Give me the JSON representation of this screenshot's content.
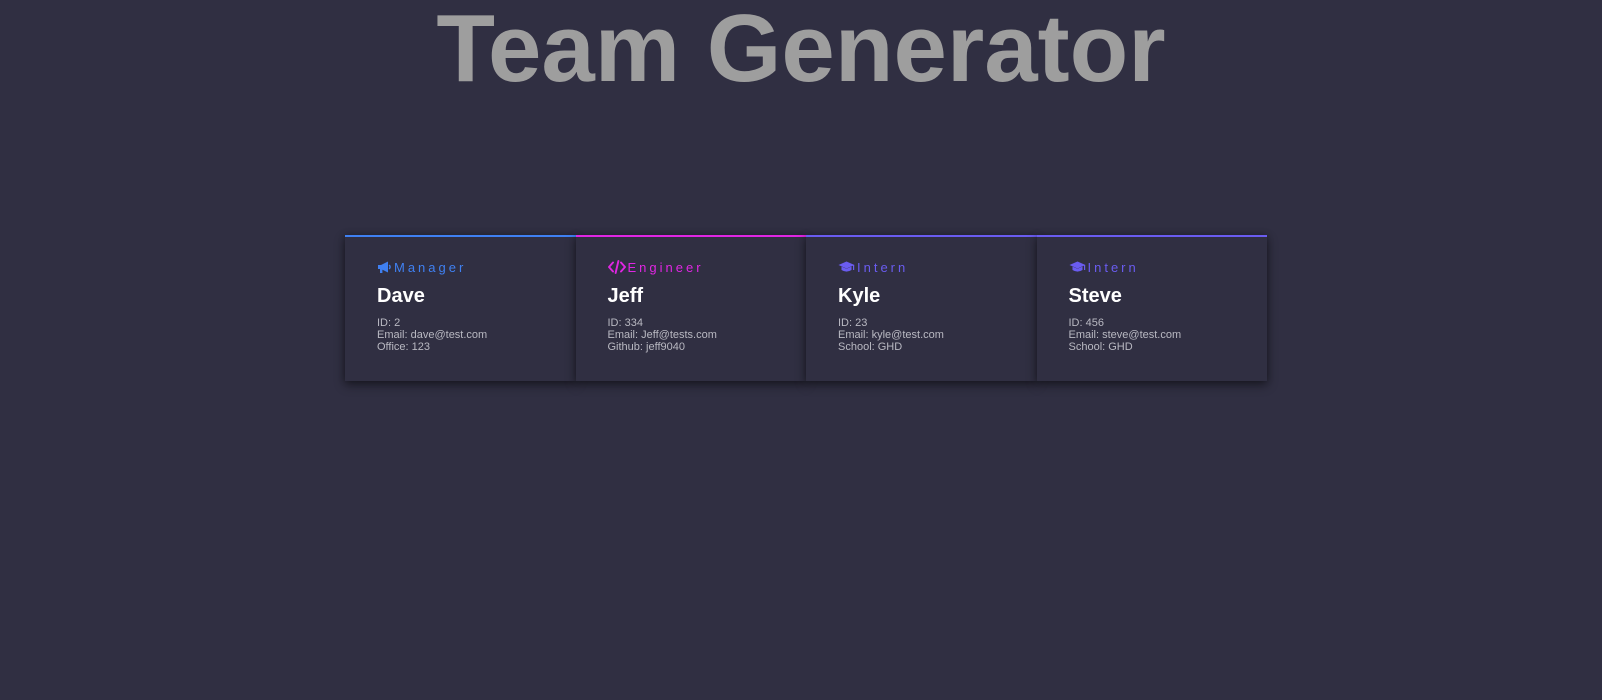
{
  "page": {
    "title": "Team Generator"
  },
  "colors": {
    "background": "#302f42",
    "title": "#9e9e9e",
    "manager": "#3f80f2",
    "engineer": "#e026e3",
    "intern": "#6a5cf0",
    "name": "#ffffff",
    "details": "#b9b9c2"
  },
  "team": [
    {
      "role": "Manager",
      "icon": "megaphone-icon",
      "name": "Dave",
      "id_text": "ID: 2",
      "email_text": "Email: dave@test.com",
      "extra_text": "Office: 123"
    },
    {
      "role": "Engineer",
      "icon": "code-icon",
      "name": "Jeff",
      "id_text": "ID: 334",
      "email_text": "Email: Jeff@tests.com",
      "extra_text": "Github: jeff9040"
    },
    {
      "role": "Intern",
      "icon": "graduation-cap-icon",
      "name": "Kyle",
      "id_text": "ID: 23",
      "email_text": "Email: kyle@test.com",
      "extra_text": "School: GHD"
    },
    {
      "role": "Intern",
      "icon": "graduation-cap-icon",
      "name": "Steve",
      "id_text": "ID: 456",
      "email_text": "Email: steve@test.com",
      "extra_text": "School: GHD"
    }
  ]
}
